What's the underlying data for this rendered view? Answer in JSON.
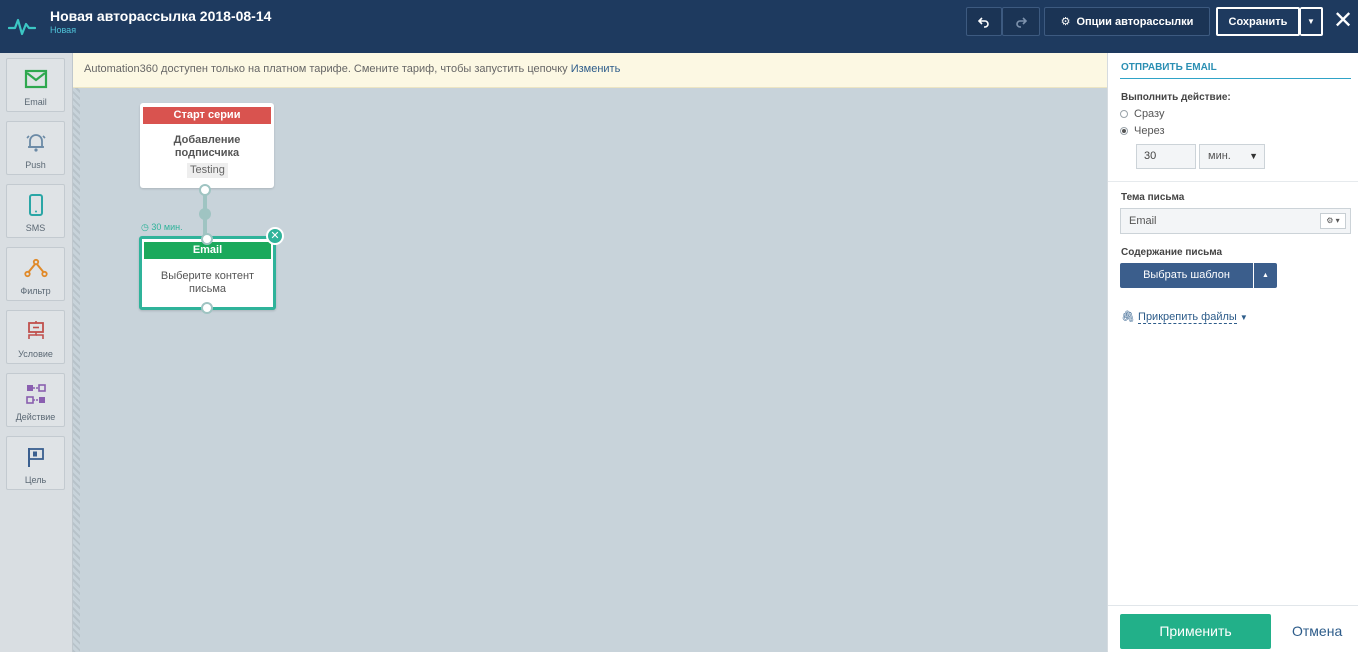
{
  "header": {
    "title": "Новая авторассылка 2018-08-14",
    "status": "Новая",
    "options_label": "Опции авторассылки",
    "save_label": "Сохранить",
    "icons": {
      "undo": "undo-icon",
      "redo": "redo-icon",
      "gear": "gear-icon",
      "close": "close-icon"
    }
  },
  "toolbar": {
    "items": [
      {
        "label": "Email",
        "icon": "envelope-icon",
        "color": "#2fa84f"
      },
      {
        "label": "Push",
        "icon": "bell-icon",
        "color": "#6b8aa6"
      },
      {
        "label": "SMS",
        "icon": "phone-icon",
        "color": "#2aa6a6"
      },
      {
        "label": "Фильтр",
        "icon": "filter-branch-icon",
        "color": "#e08a2a"
      },
      {
        "label": "Условие",
        "icon": "condition-icon",
        "color": "#c0504d"
      },
      {
        "label": "Действие",
        "icon": "action-icon",
        "color": "#8a5fb0"
      },
      {
        "label": "Цель",
        "icon": "flag-icon",
        "color": "#3a5f8f"
      }
    ]
  },
  "banner": {
    "text": "Automation360 доступен только на платном тарифе. Смените тариф, чтобы запустить цепочку ",
    "link": "Изменить"
  },
  "canvas": {
    "start_node": {
      "header": "Старт серии",
      "title_line1": "Добавление",
      "title_line2": "подписчика",
      "tag": "Testing"
    },
    "delay": "30 мин.",
    "email_node": {
      "header": "Email",
      "body_line1": "Выберите контент",
      "body_line2": "письма"
    }
  },
  "panel": {
    "title": "ОТПРАВИТЬ EMAIL",
    "action_label": "Выполнить действие:",
    "options": [
      {
        "label": "Сразу",
        "selected": false
      },
      {
        "label": "Через",
        "selected": true
      }
    ],
    "delay_value": "30",
    "delay_unit": "мин.",
    "subject_label": "Тема письма",
    "subject_value": "Email",
    "content_label": "Содержание письма",
    "template_button": "Выбрать шаблон",
    "attach_label": "Прикрепить файлы",
    "apply_label": "Применить",
    "cancel_label": "Отмена"
  },
  "colors": {
    "header_bg": "#1e3a5f",
    "accent": "#2fb39a",
    "start_red": "#d9534f",
    "email_green": "#1ba95c",
    "apply_green": "#22b089"
  }
}
